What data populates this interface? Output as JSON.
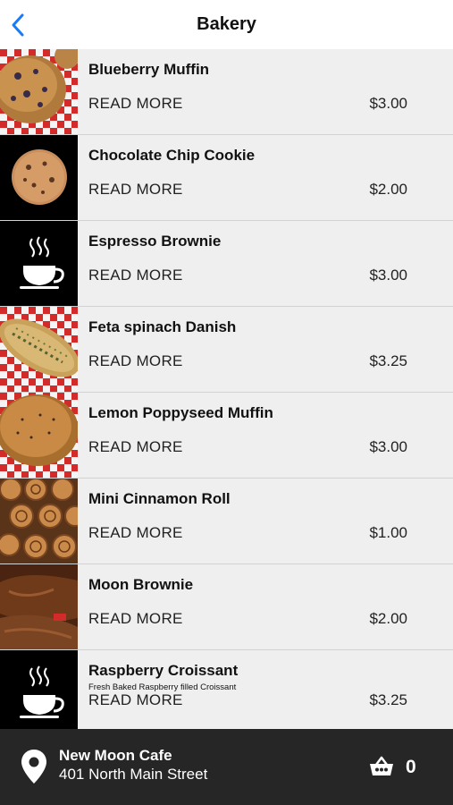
{
  "header": {
    "title": "Bakery",
    "back_icon": "chevron-left-icon",
    "accent": "#1a7cf5"
  },
  "items": [
    {
      "name": "Blueberry Muffin",
      "description": "",
      "read_more": "READ MORE",
      "price": "$3.00",
      "image": "blueberry-muffin-photo"
    },
    {
      "name": "Chocolate Chip Cookie",
      "description": "",
      "read_more": "READ MORE",
      "price": "$2.00",
      "image": "cookie-photo"
    },
    {
      "name": "Espresso Brownie",
      "description": "",
      "read_more": "READ MORE",
      "price": "$3.00",
      "image": "coffee-cup-placeholder-icon"
    },
    {
      "name": "Feta spinach Danish",
      "description": "",
      "read_more": "READ MORE",
      "price": "$3.25",
      "image": "danish-photo"
    },
    {
      "name": "Lemon Poppyseed Muffin",
      "description": "",
      "read_more": "READ MORE",
      "price": "$3.00",
      "image": "lemon-muffin-photo"
    },
    {
      "name": "Mini Cinnamon Roll",
      "description": "",
      "read_more": "READ MORE",
      "price": "$1.00",
      "image": "cinnamon-roll-photo"
    },
    {
      "name": "Moon Brownie",
      "description": "",
      "read_more": "READ MORE",
      "price": "$2.00",
      "image": "brownie-photo"
    },
    {
      "name": "Raspberry Croissant",
      "description": "Fresh Baked Raspberry filled Croissant",
      "read_more": "READ MORE",
      "price": "$3.25",
      "image": "coffee-cup-placeholder-icon"
    }
  ],
  "footer": {
    "cafe_name": "New Moon Cafe",
    "address": "401 North Main Street",
    "cart_count": "0",
    "location_icon": "map-pin-icon",
    "cart_icon": "basket-icon",
    "background": "#262626"
  }
}
